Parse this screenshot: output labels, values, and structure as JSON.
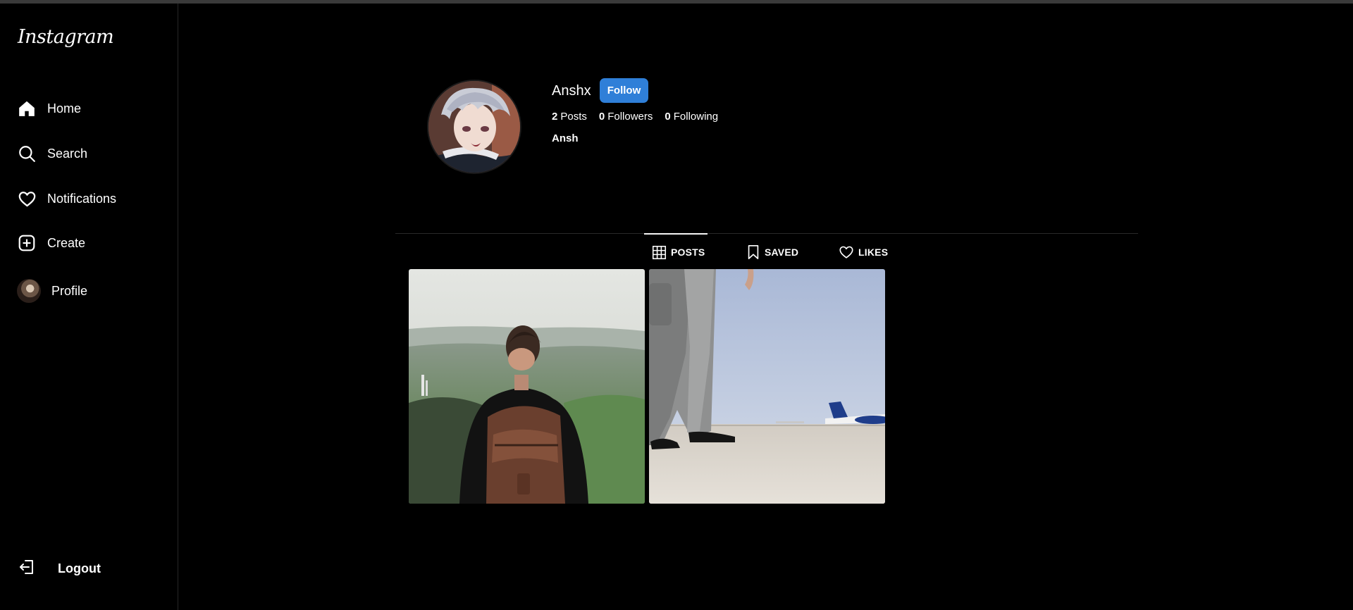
{
  "app": {
    "brand": "Instagram"
  },
  "sidebar": {
    "items": [
      {
        "label": "Home",
        "icon": "home-icon"
      },
      {
        "label": "Search",
        "icon": "search-icon"
      },
      {
        "label": "Notifications",
        "icon": "heart-icon"
      },
      {
        "label": "Create",
        "icon": "plus-square-icon"
      },
      {
        "label": "Profile",
        "icon": "avatar"
      }
    ],
    "logout_label": "Logout"
  },
  "profile": {
    "username": "Anshx",
    "follow_label": "Follow",
    "posts_count": "2",
    "posts_label": "Posts",
    "followers_count": "0",
    "followers_label": "Followers",
    "following_count": "0",
    "following_label": "Following",
    "full_name": "Ansh"
  },
  "tabs": [
    {
      "label": "POSTS",
      "icon": "grid-icon",
      "active": true
    },
    {
      "label": "SAVED",
      "icon": "bookmark-icon",
      "active": false
    },
    {
      "label": "LIKES",
      "icon": "heart-icon",
      "active": false
    }
  ],
  "posts": [
    {
      "subject": "person with backpack overlooking valley"
    },
    {
      "subject": "man in suit walking on airport tarmac"
    }
  ],
  "colors": {
    "background": "#000000",
    "accent": "#2f7fd8",
    "divider": "#2a2a2a"
  }
}
